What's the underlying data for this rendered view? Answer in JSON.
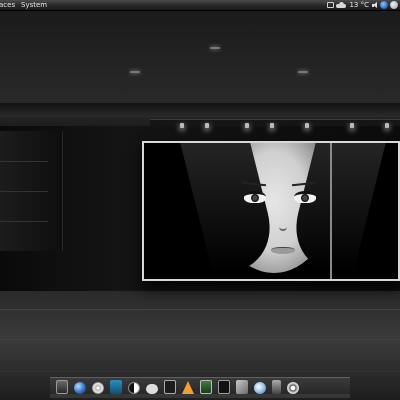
{
  "top_panel": {
    "menus": [
      "aces",
      "System"
    ],
    "temperature": "13 °C",
    "tray_icons": [
      "network-icon",
      "weather-icon",
      "volume-icon",
      "swirl-app-icon",
      "power-icon"
    ]
  },
  "wallpaper": {
    "description_icon": "gallery-portrait-wallpaper"
  },
  "dock": {
    "icons": [
      "monitor-icon",
      "globe-browser-icon",
      "disc-icon",
      "document-icon",
      "contrast-icon",
      "chat-icon",
      "film-icon",
      "vlc-cone-icon",
      "image-viewer-icon",
      "terminal-icon",
      "tools-icon",
      "swirl-icon",
      "trash-icon",
      "power-icon"
    ]
  }
}
